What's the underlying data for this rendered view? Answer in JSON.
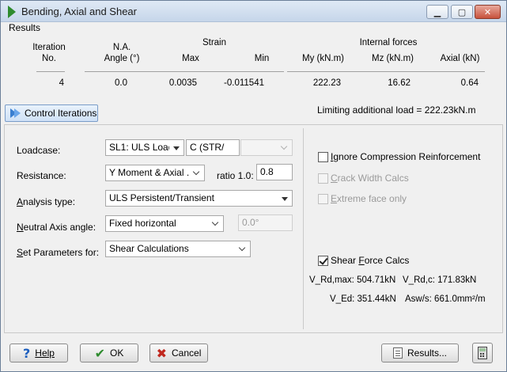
{
  "window": {
    "title": "Bending, Axial and Shear"
  },
  "results": {
    "section_label": "Results",
    "headers": {
      "iteration_line1": "Iteration",
      "iteration_line2": "No.",
      "na_line1": "N.A.",
      "na_line2": "Angle (°)",
      "strain_group": "Strain",
      "strain_max": "Max",
      "strain_min": "Min",
      "forces_group": "Internal forces",
      "my": "My (kN.m)",
      "mz": "Mz (kN.m)",
      "axial": "Axial (kN)"
    },
    "row": {
      "iteration": "4",
      "na_angle": "0.0",
      "strain_max": "0.0035",
      "strain_min": "-0.011541",
      "my": "222.23",
      "mz": "16.62",
      "axial": "0.64"
    },
    "control_iterations_label": "Control Iterations",
    "limiting_load": "Limiting additional load = 222.23kN.m"
  },
  "form": {
    "loadcase": {
      "label": "Loadcase:",
      "combo1": "SL1: ULS Loadca",
      "combo2": "C (STR/G",
      "combo3": ""
    },
    "resistance": {
      "label": "Resistance:",
      "combo": "Y Moment & Axial ...",
      "ratio_label": "ratio 1.0:",
      "ratio_value": "0.8"
    },
    "analysis_type": {
      "label": "Analysis type:",
      "combo": "ULS Persistent/Transient"
    },
    "neutral_axis": {
      "label": "Neutral Axis angle:",
      "combo": "Fixed horizontal",
      "angle_value": "0.0°"
    },
    "set_params": {
      "label": "Set Parameters for:",
      "combo": "Shear Calculations"
    }
  },
  "options": {
    "ignore_compression": {
      "label": "Ignore Compression Reinforcement",
      "checked": false,
      "enabled": true
    },
    "crack_width": {
      "label": "Crack Width Calcs",
      "checked": false,
      "enabled": false
    },
    "extreme_face": {
      "label": "Extreme face only",
      "checked": false,
      "enabled": false
    },
    "shear_force": {
      "label": "Shear Force Calcs",
      "checked": true,
      "enabled": true
    }
  },
  "shear_results": {
    "v_rd_max": "V_Rd,max: 504.71kN",
    "v_rd_c": "V_Rd,c:  171.83kN",
    "v_ed": "V_Ed: 351.44kN",
    "asw_s": "Asw/s:  661.0mm²/m"
  },
  "buttons": {
    "help": "Help",
    "ok": "OK",
    "cancel": "Cancel",
    "results": "Results..."
  },
  "icons": {
    "title": "play-icon",
    "help": "help-icon",
    "ok": "checkmark-icon",
    "cancel": "cross-icon",
    "results": "document-icon",
    "calculator": "calculator-icon"
  },
  "colors": {
    "accent": "#2e8b2e",
    "link_blue": "#1d5fbf",
    "cancel_red": "#c0281e"
  }
}
